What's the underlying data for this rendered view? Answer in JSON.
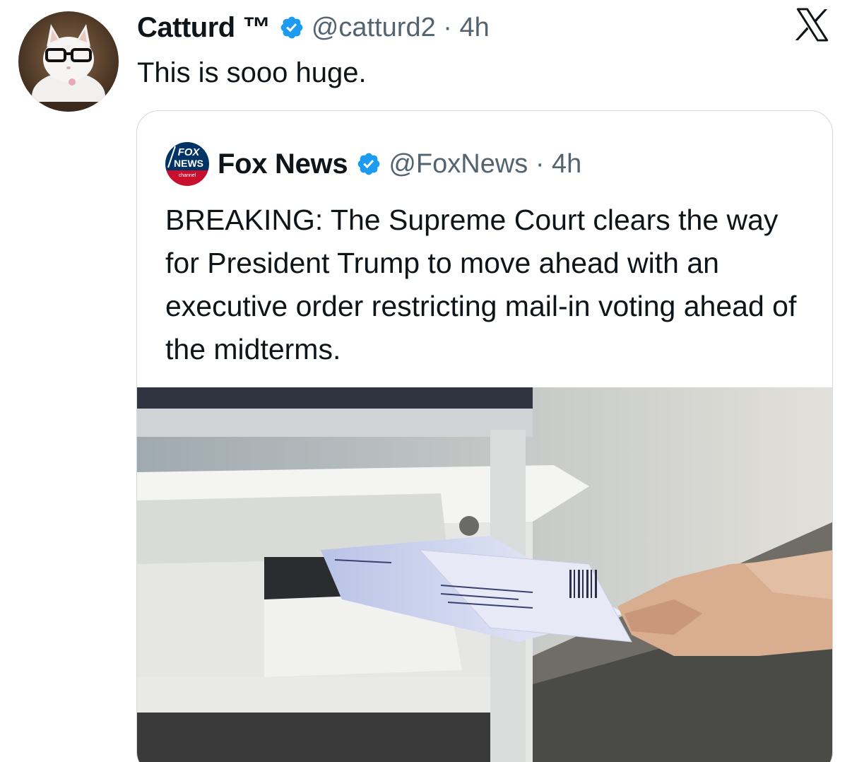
{
  "tweet": {
    "author_name": "Catturd ™",
    "author_handle": "@catturd2 · 4h",
    "text": "This is sooo huge."
  },
  "quote": {
    "author_name": "Fox News",
    "author_handle": "@FoxNews · 4h",
    "logo_text": [
      "FOX",
      "NEWS",
      "channel"
    ],
    "text": "BREAKING: The Supreme Court clears the way for President Trump to move ahead with an executive order restricting mail-in voting ahead of the midterms."
  },
  "icons": {
    "verified": "verified-badge-icon",
    "platform": "x-logo-icon"
  },
  "colors": {
    "verified_blue": "#1d9bf0",
    "text_primary": "#0f1419",
    "text_secondary": "#536471",
    "border": "#cfd9de"
  }
}
